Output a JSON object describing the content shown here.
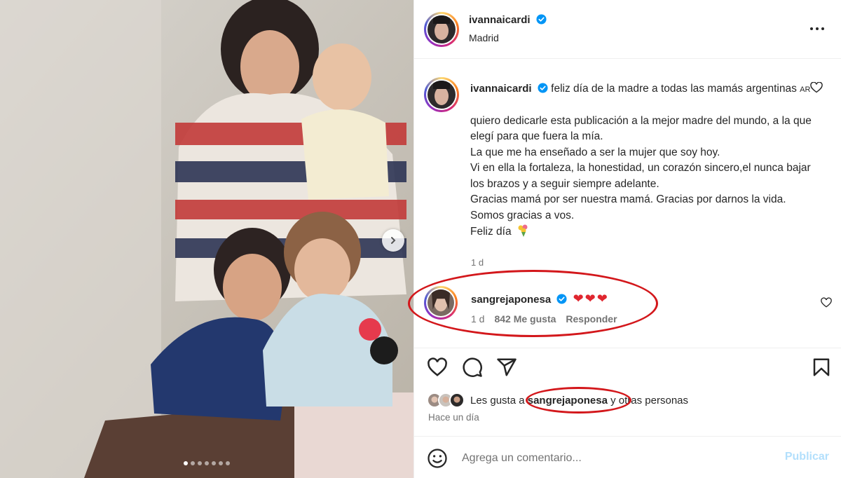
{
  "post": {
    "author": "ivannaicardi",
    "location": "Madrid",
    "more_icon": "more-horizontal-icon"
  },
  "caption": {
    "author": "ivannaicardi",
    "title_line": "feliz día de la madre a todas las mamás argentinas",
    "flag_text": "AR",
    "paragraph_1": "quiero dedicarle esta publicación a la mejor madre del mundo, a la que elegí para que fuera la mía.",
    "paragraph_2": "La que me ha enseñado a ser la mujer que soy hoy.",
    "paragraph_3": "Vi en ella la fortaleza, la honestidad, un corazón sincero,el nunca bajar los brazos y a seguir siempre adelante.",
    "paragraph_4": "Gracias mamá por ser nuestra mamá. Gracias por darnos la vida.",
    "paragraph_5": "Somos gracias a vos.",
    "paragraph_6": "Feliz día",
    "time": "1 d"
  },
  "comment": {
    "author": "sangrejaponesa",
    "text": "❤❤❤",
    "time": "1 d",
    "likes": "842 Me gusta",
    "reply": "Responder"
  },
  "actions": {
    "like_icon": "heart-icon",
    "comment_icon": "comment-icon",
    "share_icon": "share-icon",
    "save_icon": "bookmark-icon"
  },
  "likes": {
    "prefix": "Les gusta a",
    "user": "sangrejaponesa",
    "suffix": "y otras personas"
  },
  "post_date": "Hace un día",
  "add_comment": {
    "placeholder": "Agrega un comentario...",
    "publish": "Publicar"
  },
  "carousel": {
    "count": 7,
    "active": 1
  },
  "colors": {
    "verified": "#0095f6",
    "annotation": "#d3171b",
    "publish_disabled": "#b2dffc"
  }
}
